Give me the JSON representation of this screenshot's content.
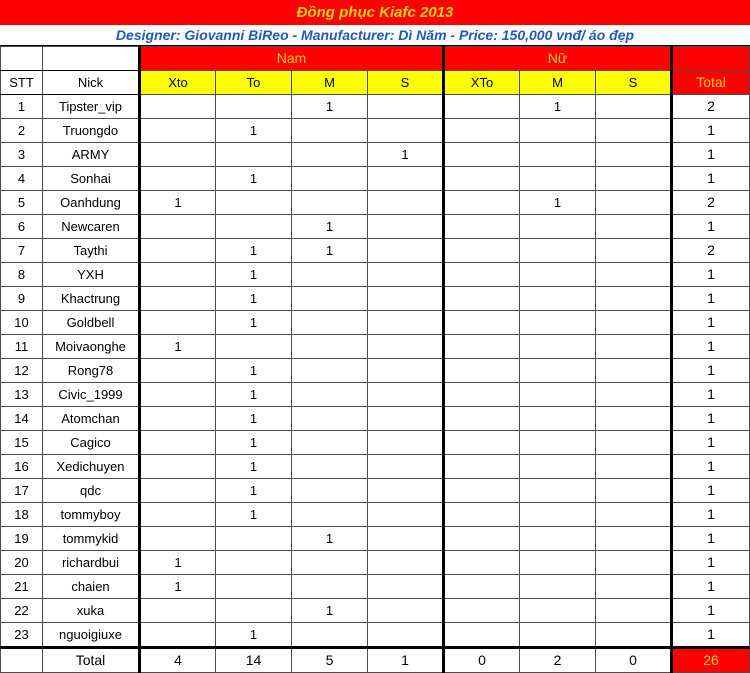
{
  "header": {
    "title": "Đồng phục Kiafc 2013",
    "subtitle": "Designer: Giovanni BiReo - Manufacturer: Dì Năm - Price: 150,000 vnđ/ áo đẹp",
    "title_bg": "#fe0000",
    "title_fg": "#ffd400",
    "subtitle_fg": "#1f5bbd"
  },
  "table": {
    "group_headers": [
      {
        "label": "Nam",
        "span": 4
      },
      {
        "label": "Nữ",
        "span": 3
      }
    ],
    "columns": {
      "stt": "STT",
      "nick": "Nick",
      "nam": [
        "Xto",
        "To",
        "M",
        "S"
      ],
      "nu": [
        "XTo",
        "M",
        "S"
      ],
      "total": "Total"
    },
    "rows": [
      {
        "stt": "1",
        "nick": "Tipster_vip",
        "nam": [
          "",
          "",
          "1",
          ""
        ],
        "nu": [
          "",
          "1",
          ""
        ],
        "total": "2"
      },
      {
        "stt": "2",
        "nick": "Truongdo",
        "nam": [
          "",
          "1",
          "",
          ""
        ],
        "nu": [
          "",
          "",
          ""
        ],
        "total": "1"
      },
      {
        "stt": "3",
        "nick": "ARMY",
        "nam": [
          "",
          "",
          "",
          "1"
        ],
        "nu": [
          "",
          "",
          ""
        ],
        "total": "1"
      },
      {
        "stt": "4",
        "nick": "Sonhai",
        "nam": [
          "",
          "1",
          "",
          ""
        ],
        "nu": [
          "",
          "",
          ""
        ],
        "total": "1"
      },
      {
        "stt": "5",
        "nick": "Oanhdung",
        "nam": [
          "1",
          "",
          "",
          ""
        ],
        "nu": [
          "",
          "1",
          ""
        ],
        "total": "2"
      },
      {
        "stt": "6",
        "nick": "Newcaren",
        "nam": [
          "",
          "",
          "1",
          ""
        ],
        "nu": [
          "",
          "",
          ""
        ],
        "total": "1"
      },
      {
        "stt": "7",
        "nick": "Taythi",
        "nam": [
          "",
          "1",
          "1",
          ""
        ],
        "nu": [
          "",
          "",
          ""
        ],
        "total": "2"
      },
      {
        "stt": "8",
        "nick": "YXH",
        "nam": [
          "",
          "1",
          "",
          ""
        ],
        "nu": [
          "",
          "",
          ""
        ],
        "total": "1"
      },
      {
        "stt": "9",
        "nick": "Khactrung",
        "nam": [
          "",
          "1",
          "",
          ""
        ],
        "nu": [
          "",
          "",
          ""
        ],
        "total": "1"
      },
      {
        "stt": "10",
        "nick": "Goldbell",
        "nam": [
          "",
          "1",
          "",
          ""
        ],
        "nu": [
          "",
          "",
          ""
        ],
        "total": "1"
      },
      {
        "stt": "11",
        "nick": "Moivaonghe",
        "nam": [
          "1",
          "",
          "",
          ""
        ],
        "nu": [
          "",
          "",
          ""
        ],
        "total": "1"
      },
      {
        "stt": "12",
        "nick": "Rong78",
        "nam": [
          "",
          "1",
          "",
          ""
        ],
        "nu": [
          "",
          "",
          ""
        ],
        "total": "1"
      },
      {
        "stt": "13",
        "nick": "Civic_1999",
        "nam": [
          "",
          "1",
          "",
          ""
        ],
        "nu": [
          "",
          "",
          ""
        ],
        "total": "1"
      },
      {
        "stt": "14",
        "nick": "Atomchan",
        "nam": [
          "",
          "1",
          "",
          ""
        ],
        "nu": [
          "",
          "",
          ""
        ],
        "total": "1"
      },
      {
        "stt": "15",
        "nick": "Cagico",
        "nam": [
          "",
          "1",
          "",
          ""
        ],
        "nu": [
          "",
          "",
          ""
        ],
        "total": "1"
      },
      {
        "stt": "16",
        "nick": "Xedichuyen",
        "nam": [
          "",
          "1",
          "",
          ""
        ],
        "nu": [
          "",
          "",
          ""
        ],
        "total": "1"
      },
      {
        "stt": "17",
        "nick": "qdc",
        "nam": [
          "",
          "1",
          "",
          ""
        ],
        "nu": [
          "",
          "",
          ""
        ],
        "total": "1"
      },
      {
        "stt": "18",
        "nick": "tommyboy",
        "nam": [
          "",
          "1",
          "",
          ""
        ],
        "nu": [
          "",
          "",
          ""
        ],
        "total": "1"
      },
      {
        "stt": "19",
        "nick": "tommykid",
        "nam": [
          "",
          "",
          "1",
          ""
        ],
        "nu": [
          "",
          "",
          ""
        ],
        "total": "1"
      },
      {
        "stt": "20",
        "nick": "richardbui",
        "nam": [
          "1",
          "",
          "",
          ""
        ],
        "nu": [
          "",
          "",
          ""
        ],
        "total": "1"
      },
      {
        "stt": "21",
        "nick": "chaien",
        "nam": [
          "1",
          "",
          "",
          ""
        ],
        "nu": [
          "",
          "",
          ""
        ],
        "total": "1"
      },
      {
        "stt": "22",
        "nick": "xuka",
        "nam": [
          "",
          "",
          "1",
          ""
        ],
        "nu": [
          "",
          "",
          ""
        ],
        "total": "1"
      },
      {
        "stt": "23",
        "nick": "nguoigiuxe",
        "nam": [
          "",
          "1",
          "",
          ""
        ],
        "nu": [
          "",
          "",
          ""
        ],
        "total": "1"
      }
    ],
    "total_row": {
      "stt": "",
      "label": "Total",
      "nam": [
        "4",
        "14",
        "5",
        "1"
      ],
      "nu": [
        "0",
        "2",
        "0"
      ],
      "total": "26"
    }
  },
  "chart_data": {
    "type": "table",
    "title": "Đồng phục Kiafc 2013",
    "categories": [
      "Nam Xto",
      "Nam To",
      "Nam M",
      "Nam S",
      "Nữ XTo",
      "Nữ M",
      "Nữ S"
    ],
    "values": [
      4,
      14,
      5,
      1,
      0,
      2,
      0
    ],
    "grand_total": 26,
    "row_count": 23
  }
}
